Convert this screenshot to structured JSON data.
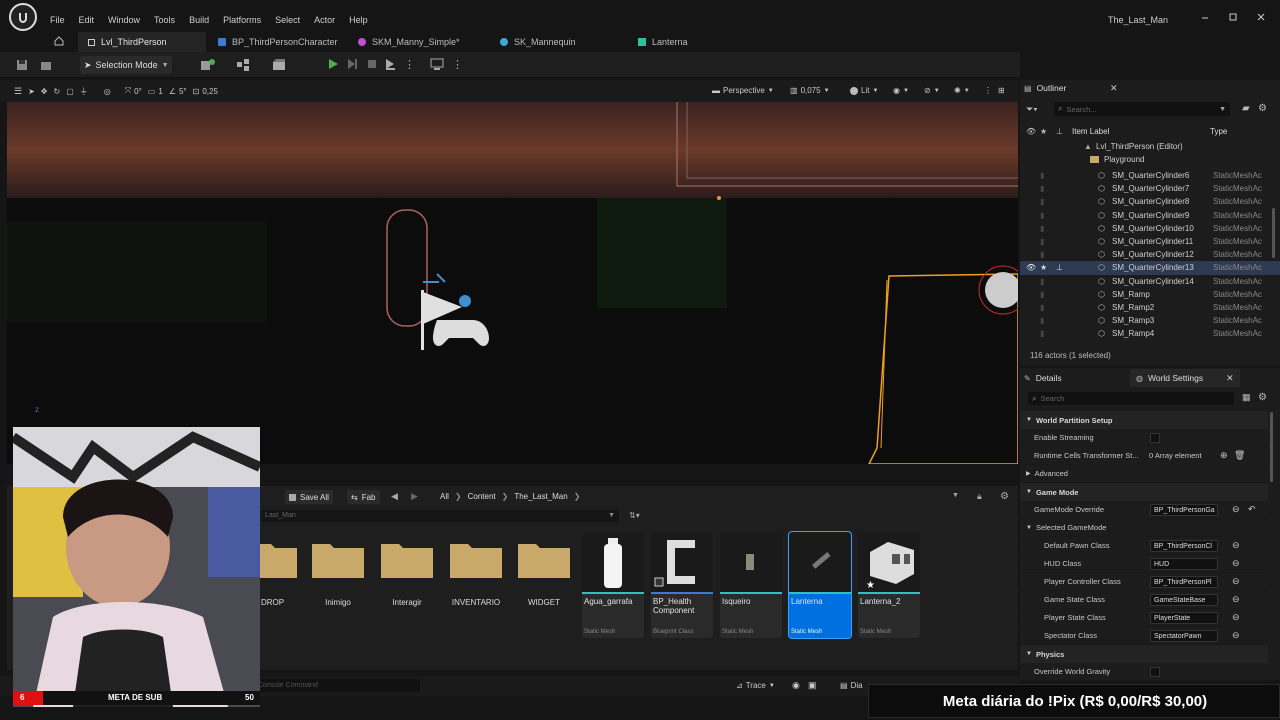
{
  "app": {
    "title": "The_Last_Man"
  },
  "menu": [
    "File",
    "Edit",
    "Window",
    "Tools",
    "Build",
    "Platforms",
    "Select",
    "Actor",
    "Help"
  ],
  "tabs": [
    {
      "label": "Lvl_ThirdPerson",
      "active": true
    },
    {
      "label": "BP_ThirdPersonCharacter"
    },
    {
      "label": "SKM_Manny_Simple*"
    },
    {
      "label": "SK_Mannequin"
    },
    {
      "label": "Lanterna"
    }
  ],
  "toolbar": {
    "mode_label": "Selection Mode"
  },
  "viewport_toolbar": {
    "rotation_snap": "0°",
    "scale_snap": "1",
    "angle": "5°",
    "scale_value": "0,25",
    "view_mode": "Perspective",
    "camera_speed": "0,075",
    "lighting": "Lit"
  },
  "outliner": {
    "title": "Outliner",
    "search_placeholder": "Search...",
    "col_label": "Item Label",
    "col_type": "Type",
    "root": "Lvl_ThirdPerson (Editor)",
    "folder": "Playground",
    "items": [
      {
        "label": "SM_QuarterCylinder6",
        "type": "StaticMeshAc"
      },
      {
        "label": "SM_QuarterCylinder7",
        "type": "StaticMeshAc"
      },
      {
        "label": "SM_QuarterCylinder8",
        "type": "StaticMeshAc"
      },
      {
        "label": "SM_QuarterCylinder9",
        "type": "StaticMeshAc"
      },
      {
        "label": "SM_QuarterCylinder10",
        "type": "StaticMeshAc"
      },
      {
        "label": "SM_QuarterCylinder11",
        "type": "StaticMeshAc"
      },
      {
        "label": "SM_QuarterCylinder12",
        "type": "StaticMeshAc"
      },
      {
        "label": "SM_QuarterCylinder13",
        "type": "StaticMeshAc",
        "selected": true
      },
      {
        "label": "SM_QuarterCylinder14",
        "type": "StaticMeshAc"
      },
      {
        "label": "SM_Ramp",
        "type": "StaticMeshAc"
      },
      {
        "label": "SM_Ramp2",
        "type": "StaticMeshAc"
      },
      {
        "label": "SM_Ramp3",
        "type": "StaticMeshAc"
      },
      {
        "label": "SM_Ramp4",
        "type": "StaticMeshAc"
      }
    ],
    "count": "116 actors (1 selected)"
  },
  "details": {
    "tab_details": "Details",
    "tab_world": "World Settings",
    "search_placeholder": "Search",
    "sections": {
      "world_partition": "World Partition Setup",
      "enable_streaming": "Enable Streaming",
      "runtime_cells": "Runtime Cells Transformer St...",
      "runtime_cells_value": "0 Array element",
      "advanced": "Advanced",
      "game_mode": "Game Mode",
      "gamemode_override": "GameMode Override",
      "gamemode_override_value": "BP_ThirdPersonGa",
      "selected_gamemode": "Selected GameMode",
      "default_pawn": "Default Pawn Class",
      "default_pawn_value": "BP_ThirdPersonCl",
      "hud": "HUD Class",
      "hud_value": "HUD",
      "player_controller": "Player Controller Class",
      "player_controller_value": "BP_ThirdPersonPl",
      "game_state": "Game State Class",
      "game_state_value": "GameStateBase",
      "player_state": "Player State Class",
      "player_state_value": "PlayerState",
      "spectator": "Spectator Class",
      "spectator_value": "SpectatorPawn",
      "physics": "Physics",
      "override_gravity": "Override World Gravity"
    }
  },
  "content_browser": {
    "save_all": "Save All",
    "fab": "Fab",
    "breadcrumb": [
      "All",
      "Content",
      "The_Last_Man"
    ],
    "path_label": "Last_Man",
    "folders": [
      "DROP",
      "Inimigo",
      "Interagir",
      "INVENTARIO",
      "WIDGET"
    ],
    "assets": [
      {
        "name": "Agua_garrafa",
        "type": "Static Mesh"
      },
      {
        "name": "BP_Health Component",
        "type": "Blueprint Class"
      },
      {
        "name": "Isqueiro",
        "type": "Static Mesh"
      },
      {
        "name": "Lanterna",
        "type": "Static Mesh",
        "selected": true
      },
      {
        "name": "Lanterna_2",
        "type": "Static Mesh"
      }
    ],
    "console_placeholder": "Console Command"
  },
  "statusbar": {
    "trace": "Trace",
    "derived": "Dia"
  },
  "overlay": {
    "sub_goal_label": "META DE SUB",
    "sub_goal_current": "6",
    "sub_goal_target": "50",
    "sub_goal_progress": 0.12,
    "pix_text": "Meta diária do !Pix (R$ 0,00/R$ 30,00)"
  },
  "colors": {
    "accent": "#0070e0",
    "selection_orange": "#f0a020",
    "bg": "#151515"
  }
}
